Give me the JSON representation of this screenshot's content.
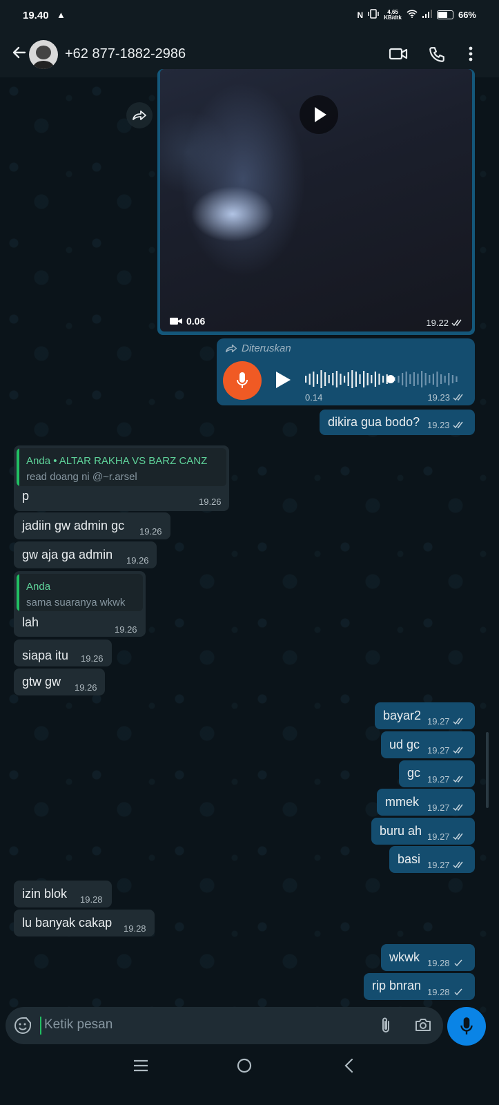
{
  "status_bar": {
    "time": "19.40",
    "network_speed_top": "4,65",
    "network_speed_bottom": "KB/dtk",
    "battery": "66%"
  },
  "header": {
    "contact_name": "+62 877-1882-2986"
  },
  "video_message": {
    "duration": "0.06",
    "time": "19.22"
  },
  "voice_message": {
    "forwarded_label": "Diteruskan",
    "duration": "0.14",
    "time": "19.23"
  },
  "messages": [
    {
      "dir": "out",
      "text": "dikira gua bodo?",
      "time": "19.23"
    },
    {
      "dir": "in",
      "quote_author": "Anda • ALTAR RAKHA VS BARZ CANZ",
      "quote_text": "read doang ni @~r.arsel",
      "text": "p",
      "time": "19.26"
    },
    {
      "dir": "in",
      "text": "jadiin gw admin gc",
      "time": "19.26"
    },
    {
      "dir": "in",
      "text": "gw aja ga admin",
      "time": "19.26"
    },
    {
      "dir": "in",
      "quote_author": "Anda",
      "quote_text": "sama suaranya wkwk",
      "text": "lah",
      "time": "19.26"
    },
    {
      "dir": "in",
      "text": "siapa itu",
      "time": "19.26"
    },
    {
      "dir": "in",
      "text": "gtw gw",
      "time": "19.26"
    },
    {
      "dir": "out",
      "text": "bayar2",
      "time": "19.27"
    },
    {
      "dir": "out",
      "text": "ud gc",
      "time": "19.27"
    },
    {
      "dir": "out",
      "text": "gc",
      "time": "19.27"
    },
    {
      "dir": "out",
      "text": "mmek",
      "time": "19.27"
    },
    {
      "dir": "out",
      "text": "buru ah",
      "time": "19.27"
    },
    {
      "dir": "out",
      "text": "basi",
      "time": "19.27"
    },
    {
      "dir": "in",
      "text": "izin blok",
      "time": "19.28"
    },
    {
      "dir": "in",
      "text": "lu banyak cakap",
      "time": "19.28"
    },
    {
      "dir": "out",
      "text": "wkwk",
      "time": "19.28"
    },
    {
      "dir": "out",
      "text": "rip bnran",
      "time": "19.28"
    }
  ],
  "composer": {
    "placeholder": "Ketik pesan"
  },
  "colors": {
    "outgoing_bubble": "#144d6f",
    "incoming_bubble": "#202c33",
    "accent_green": "#21c063",
    "mic_button": "#0a84e6",
    "voice_mic": "#f05a24"
  }
}
